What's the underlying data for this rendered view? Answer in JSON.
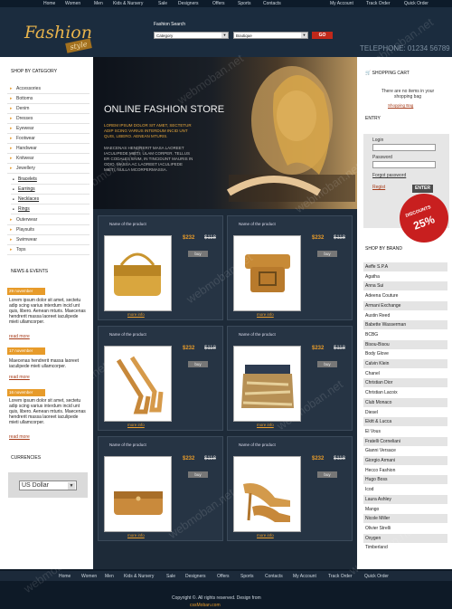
{
  "topnav": {
    "left": [
      "Home",
      "Women",
      "Men",
      "Kids & Nursery",
      "Sale",
      "Designers",
      "Offers",
      "Sports",
      "Contacts"
    ],
    "right": [
      "My Account",
      "Track Order",
      "Quick Order"
    ]
  },
  "header": {
    "logo_main": "Fashion",
    "logo_sub": "style",
    "search_label": "Fashion Search",
    "select1": "Category",
    "select2": "Boutique",
    "go": "GO",
    "phone": "TELEPHONE: 01234 56789"
  },
  "left": {
    "shop_by_category": "SHOP BY CATEGORY",
    "categories": [
      "Accessories",
      "Bottoms",
      "Denim",
      "Dresses",
      "Eyewear",
      "Footwear",
      "Handwear",
      "Knitwear",
      "Jewellery"
    ],
    "subcategories": [
      "Bracelets",
      "Earrings",
      "Necklaces",
      "Rings"
    ],
    "categories2": [
      "Outerwear",
      "Playsuits",
      "Swimwear",
      "Tops"
    ],
    "news_title": "NEWS & EVENTS",
    "news": [
      {
        "date": "29 november",
        "text": "Lorem ipsum dolor sit amet, sectetu adip scing varius interdum incid unt quis, libero. Aenean mturis. Maecenas hendrerit massa laoreet iaculipede mieti ullamcorper.",
        "more": "read more"
      },
      {
        "date": "17 november",
        "text": "Maecenas hendrerit massa laoreet iaculipede mieti ullamcorper.",
        "more": "read more"
      },
      {
        "date": "16 november",
        "text": "Lorem ipsum dolor sit amet, sectetu adip scing varius interdum incid unt quis, libero. Aenean mturis. Maecenas hendrerit massa laoreet iaculipede mieti ullamcorper.",
        "more": "read more"
      }
    ],
    "currencies_title": "CURRENCIES",
    "currency": "US Dollar"
  },
  "hero": {
    "title": "ONLINE FASHION STORE",
    "text1": "LOREM IPSUM DOLOR SIT AMET, SECTETUR ADIP SCING VARIUS INTERDUM INCID UNT QUIS, LIBERO. AENEAN MTURIS.",
    "text2": "MAECENAS HENDRERIT MASA LAOREET IACULIPEDE MIETI, ULAM CORPER. TELLUS ER CODALES ENIM, IN TINCIDUNT MAURIS IN ODIO. MASSA AC LAOREET IACULIPEDE MIETI, NULLA MCORPERMASSA."
  },
  "products": [
    {
      "name": "Name of the product",
      "price": "$232",
      "old": "$118",
      "buy": "buy",
      "more": "more info",
      "img": "gold-handbag-image"
    },
    {
      "name": "Name of the product",
      "price": "$232",
      "old": "$118",
      "buy": "buy",
      "more": "more info",
      "img": "gold-belt-image"
    },
    {
      "name": "Name of the product",
      "price": "$232",
      "old": "$118",
      "buy": "buy",
      "more": "more info",
      "img": "gold-sandals-image"
    },
    {
      "name": "Name of the product",
      "price": "$232",
      "old": "$118",
      "buy": "buy",
      "more": "more info",
      "img": "sequin-skirt-image"
    },
    {
      "name": "Name of the product",
      "price": "$232",
      "old": "$118",
      "buy": "buy",
      "more": "more info",
      "img": "clutch-bag-image"
    },
    {
      "name": "Name of the product",
      "price": "$232",
      "old": "$118",
      "buy": "buy",
      "more": "more info",
      "img": "high-heels-image"
    }
  ],
  "right": {
    "cart_title": "SHOPPING CART",
    "cart_text": "There are no items in your shopping bag",
    "cart_link": "Shopping Bag",
    "entry": "ENTRY",
    "login_label": "Login",
    "password_label": "Password",
    "forgot": "Forgot password",
    "register": "Regist",
    "enter": "ENTER",
    "discount_label": "DISCOUNTS",
    "discount_value": "25%",
    "brand_title": "SHOP BY BRAND",
    "brands": [
      "Aeffe S.P.A",
      "Agatha",
      "Anna Sui",
      "Adeena Couture",
      "Armani Exchange",
      "Austin Reed",
      "Babette Wasserman",
      "BCBG",
      "Bisou-Bisou",
      "Body Glove",
      "Calvin Klein",
      "Chanel",
      "Christian Dior",
      "Christian Lacoix",
      "Club Monaco",
      "Diesel",
      "Ekitt & Lucca",
      "El Vous",
      "Fratelli Corneliani",
      "Gianni Versace",
      "Giorgio Armani",
      "Hecco Fashion",
      "Hugo Boss",
      "Icod",
      "Laura Ashley",
      "Mango",
      "Nicole Miller",
      "Olivier Strelli",
      "Oxygen",
      "Timberland"
    ]
  },
  "footer": {
    "nav": [
      "Home",
      "Women",
      "Men",
      "Kids & Nursery",
      "Sale",
      "Designers",
      "Offers",
      "Sports",
      "Contacts",
      "My Account",
      "Track Order",
      "Quick Order"
    ],
    "copyright": "Copyright ©. All rights reserved. Design from",
    "link": "cssMoban.com"
  },
  "watermark": "webmoban.net",
  "colors": {
    "accent": "#e79b2a",
    "dark": "#1d2a38",
    "red": "#c81f1f"
  }
}
